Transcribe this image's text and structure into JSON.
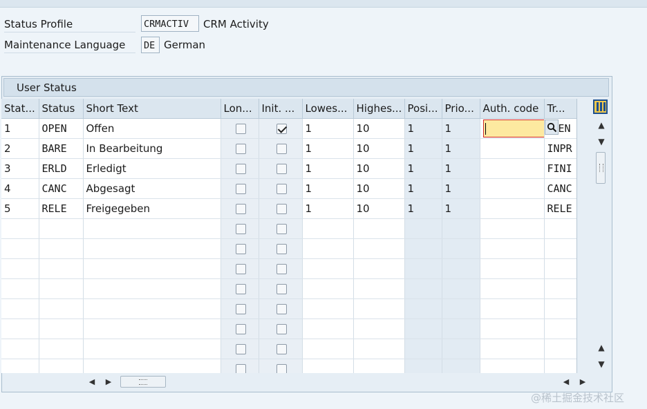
{
  "header": {
    "status_profile": {
      "label": "Status Profile",
      "value": "CRMACTIV",
      "description": "CRM Activity"
    },
    "maintenance_language": {
      "label": "Maintenance Language",
      "value": "DE",
      "description": "German"
    }
  },
  "panel": {
    "title": "User Status"
  },
  "table": {
    "columns": [
      "Stat...",
      "Status",
      "Short Text",
      "Lon...",
      "Init. ...",
      "Lowes...",
      "Highes...",
      "Posi...",
      "Prio...",
      "Auth. code",
      "Tr..."
    ],
    "rows": [
      {
        "stat": "1",
        "status": "OPEN",
        "short_text": "Offen",
        "long": false,
        "init": true,
        "lowest": "1",
        "highest": "10",
        "pos": "1",
        "prio": "1",
        "auth": "",
        "trans": "EN"
      },
      {
        "stat": "2",
        "status": "BARE",
        "short_text": "In Bearbeitung",
        "long": false,
        "init": false,
        "lowest": "1",
        "highest": "10",
        "pos": "1",
        "prio": "1",
        "auth": "",
        "trans": "INPR"
      },
      {
        "stat": "3",
        "status": "ERLD",
        "short_text": "Erledigt",
        "long": false,
        "init": false,
        "lowest": "1",
        "highest": "10",
        "pos": "1",
        "prio": "1",
        "auth": "",
        "trans": "FINI"
      },
      {
        "stat": "4",
        "status": "CANC",
        "short_text": "Abgesagt",
        "long": false,
        "init": false,
        "lowest": "1",
        "highest": "10",
        "pos": "1",
        "prio": "1",
        "auth": "",
        "trans": "CANC"
      },
      {
        "stat": "5",
        "status": "RELE",
        "short_text": "Freigegeben",
        "long": false,
        "init": false,
        "lowest": "1",
        "highest": "10",
        "pos": "1",
        "prio": "1",
        "auth": "",
        "trans": "RELE"
      }
    ]
  },
  "icons": {
    "column_settings": "column-settings-icon",
    "value_help": "search-icon",
    "scroll_up": "▲",
    "scroll_down": "▼",
    "scroll_left": "◀",
    "scroll_right": "▶"
  },
  "watermark": "@稀土掘金技术社区"
}
